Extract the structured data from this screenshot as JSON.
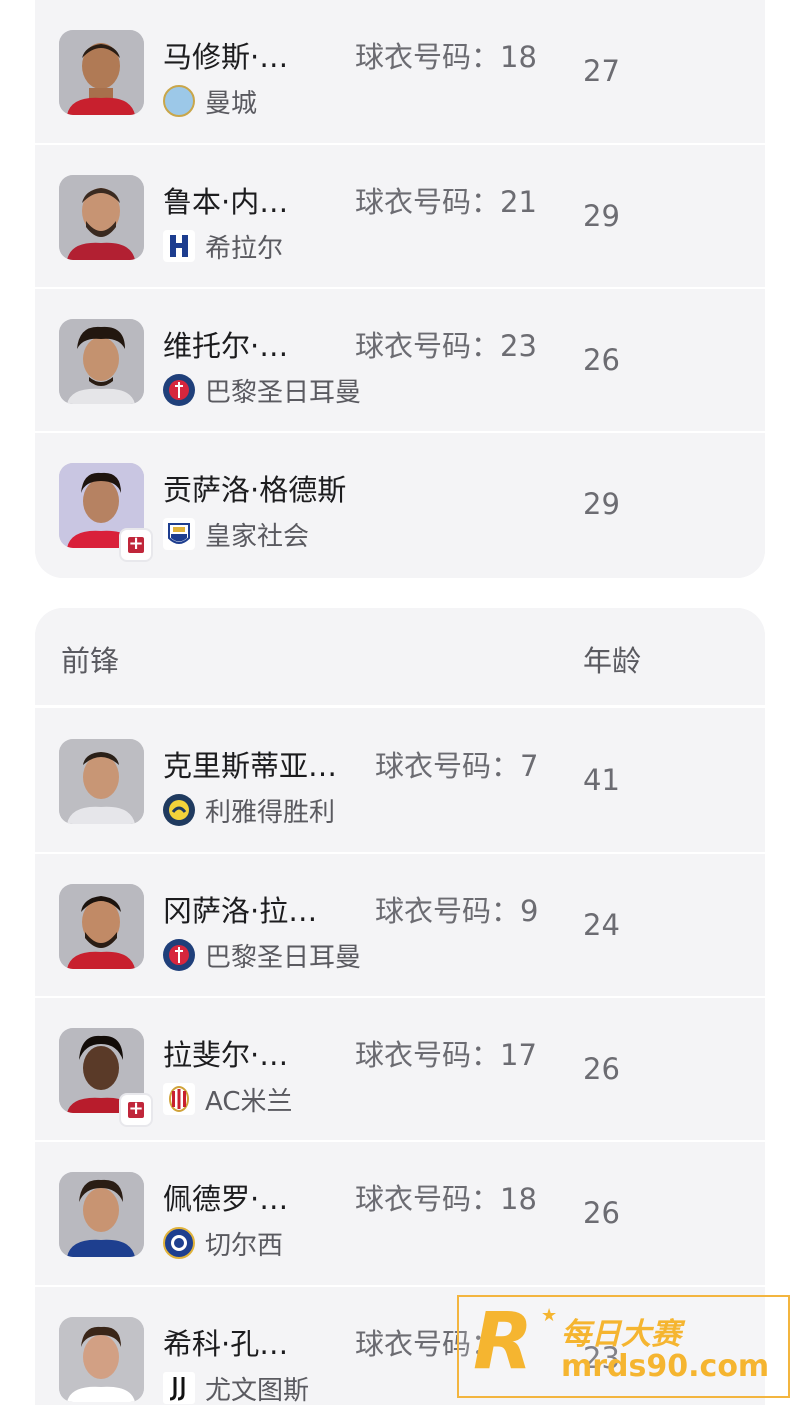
{
  "midfield_rows": [
    {
      "name": "马修斯·…",
      "jersey": "球衣号码：18",
      "age": "27",
      "club": "曼城",
      "club_icon": "man-city-crest",
      "injured": false
    },
    {
      "name": "鲁本·内…",
      "jersey": "球衣号码：21",
      "age": "29",
      "club": "希拉尔",
      "club_icon": "al-hilal-crest",
      "injured": false
    },
    {
      "name": "维托尔·…",
      "jersey": "球衣号码：23",
      "age": "26",
      "club": "巴黎圣日耳曼",
      "club_icon": "psg-crest",
      "injured": false
    },
    {
      "name": "贡萨洛·格德斯",
      "jersey": "",
      "age": "29",
      "club": "皇家社会",
      "club_icon": "real-sociedad-crest",
      "injured": true
    }
  ],
  "forwards": {
    "title": "前锋",
    "age_header": "年龄",
    "rows": [
      {
        "name": "克里斯蒂亚…",
        "jersey": "球衣号码：7",
        "age": "41",
        "club": "利雅得胜利",
        "club_icon": "al-nassr-crest",
        "injured": false
      },
      {
        "name": "冈萨洛·拉…",
        "jersey": "球衣号码：9",
        "age": "24",
        "club": "巴黎圣日耳曼",
        "club_icon": "psg-crest",
        "injured": false
      },
      {
        "name": "拉斐尔·…",
        "jersey": "球衣号码：17",
        "age": "26",
        "club": "AC米兰",
        "club_icon": "ac-milan-crest",
        "injured": true
      },
      {
        "name": "佩德罗·…",
        "jersey": "球衣号码：18",
        "age": "26",
        "club": "切尔西",
        "club_icon": "chelsea-crest",
        "injured": false
      },
      {
        "name": "希科·孔…",
        "jersey": "球衣号码：",
        "age": "23",
        "club": "尤文图斯",
        "club_icon": "juventus-crest",
        "injured": false
      }
    ]
  },
  "watermark": {
    "letter": "R",
    "line1": "每日大赛",
    "line2": "mrds90.com"
  },
  "colors": {
    "card_bg": "#f4f4f6",
    "muted_text": "#6c6c72",
    "injury": "#c0263a",
    "watermark": "#f5b530"
  }
}
